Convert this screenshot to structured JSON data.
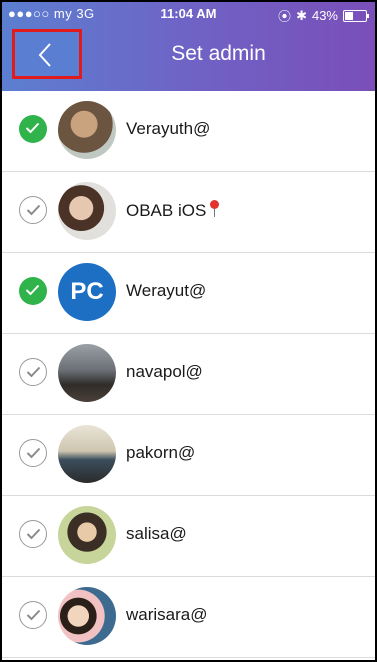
{
  "status_bar": {
    "carrier": "●●●○○ my  3G",
    "time": "11:04 AM",
    "battery_text": "43%",
    "battery_level": 0.43
  },
  "header": {
    "title": "Set admin"
  },
  "users": [
    {
      "name": "Verayuth@",
      "selected": true,
      "avatar": "photo-avatar"
    },
    {
      "name": "OBAB iOS",
      "selected": false,
      "avatar": "photo-avatar",
      "pin_icon": "map-pin-icon"
    },
    {
      "name": "Werayut@",
      "selected": true,
      "avatar": "pc-logo",
      "avatar_text": "PC"
    },
    {
      "name": "navapol@",
      "selected": false,
      "avatar": "photo-avatar"
    },
    {
      "name": "pakorn@",
      "selected": false,
      "avatar": "photo-avatar"
    },
    {
      "name": "salisa@",
      "selected": false,
      "avatar": "photo-avatar"
    },
    {
      "name": "warisara@",
      "selected": false,
      "avatar": "photo-avatar"
    }
  ],
  "colors": {
    "selected_check": "#2fb34a",
    "header_gradient_start": "#5c7fd0",
    "header_gradient_end": "#7a4fb8",
    "highlight_border": "#e01b1b"
  }
}
